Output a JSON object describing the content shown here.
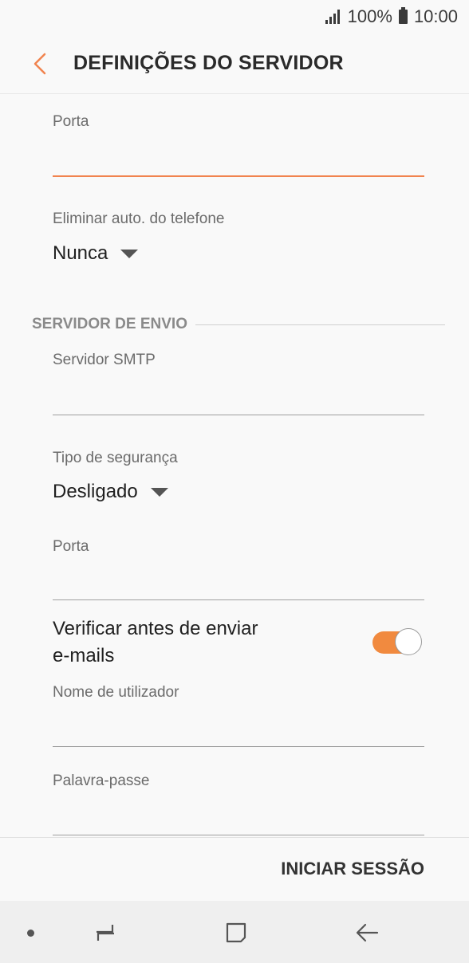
{
  "status_bar": {
    "battery_percent": "100%",
    "time": "10:00"
  },
  "header": {
    "title": "DEFINIÇÕES DO SERVIDOR"
  },
  "incoming": {
    "port_label": "Porta",
    "port_value": "",
    "auto_delete_label": "Eliminar auto. do telefone",
    "auto_delete_value": "Nunca"
  },
  "outgoing": {
    "section_title": "SERVIDOR DE ENVIO",
    "smtp_label": "Servidor SMTP",
    "smtp_value": "",
    "security_label": "Tipo de segurança",
    "security_value": "Desligado",
    "port_label": "Porta",
    "port_value": "",
    "verify_label_line1": "Verificar antes de enviar",
    "verify_label_line2": "e-mails",
    "verify_enabled": true,
    "username_label": "Nome de utilizador",
    "username_value": "",
    "password_label": "Palavra-passe",
    "password_value": ""
  },
  "footer": {
    "signin_label": "INICIAR SESSÃO"
  },
  "colors": {
    "accent": "#f1844f",
    "toggle_on": "#f18a3f"
  }
}
